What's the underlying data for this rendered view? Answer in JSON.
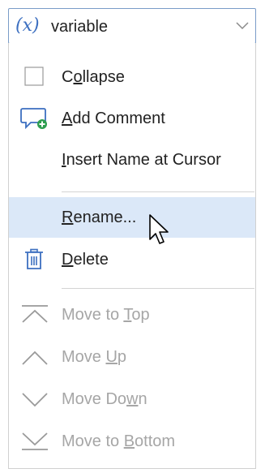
{
  "dropdown": {
    "icon": "variable-icon",
    "icon_text": "(x)",
    "value": "variable",
    "chevron": "chevron-down-icon"
  },
  "menu": {
    "collapse": {
      "label": "Collapse",
      "mnemonic": "o",
      "icon": "checkbox-icon"
    },
    "add_comment": {
      "label": "Add Comment",
      "mnemonic": "A",
      "icon": "add-comment-icon"
    },
    "insert_name": {
      "label": "Insert Name at Cursor",
      "mnemonic": "I"
    },
    "rename": {
      "label": "Rename...",
      "mnemonic": "R",
      "highlighted": true
    },
    "delete": {
      "label": "Delete",
      "mnemonic": "D",
      "icon": "trash-icon"
    },
    "move_top": {
      "label": "Move to Top",
      "mnemonic": "T",
      "icon": "move-top-icon",
      "enabled": false
    },
    "move_up": {
      "label": "Move Up",
      "mnemonic": "U",
      "icon": "move-up-icon",
      "enabled": false
    },
    "move_down": {
      "label": "Move Down",
      "mnemonic": "w",
      "icon": "move-down-icon",
      "enabled": false
    },
    "move_bottom": {
      "label": "Move to Bottom",
      "mnemonic": "B",
      "icon": "move-bottom-icon",
      "enabled": false
    }
  },
  "colors": {
    "accent": "#3c6fc0",
    "highlight": "#dbe8f8",
    "add_comment_badge": "#2e9e4f",
    "disabled_text": "#a6a6a6"
  }
}
